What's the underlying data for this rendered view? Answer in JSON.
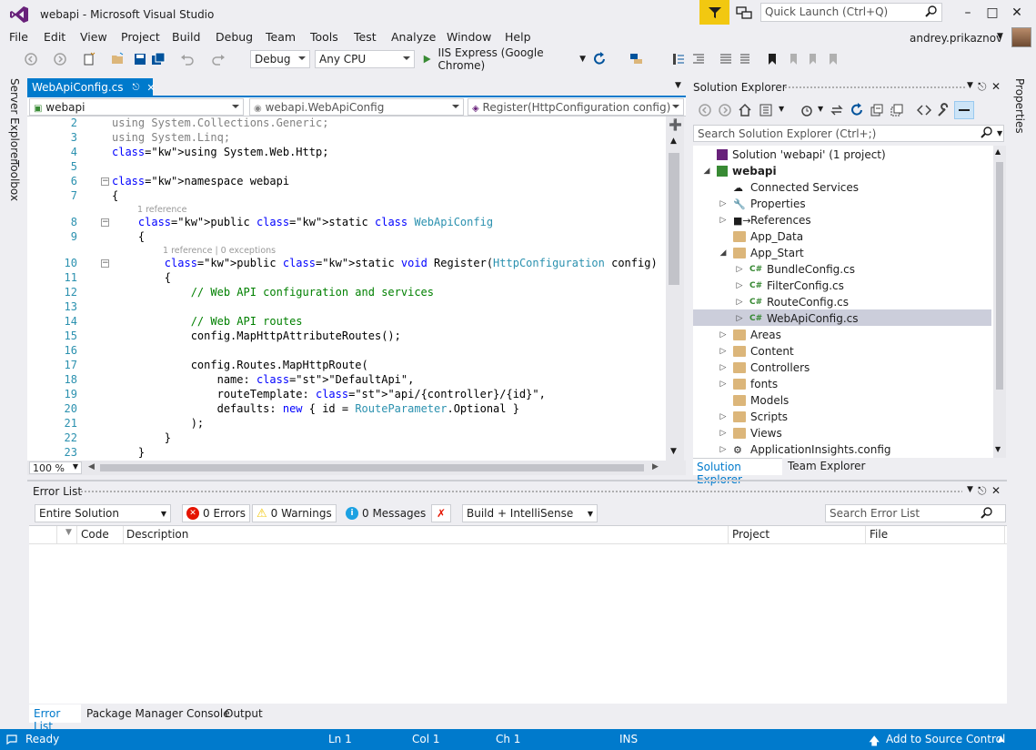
{
  "window": {
    "title": "webapi - Microsoft Visual Studio",
    "quick_launch_placeholder": "Quick Launch (Ctrl+Q)",
    "user": "andrey.prikaznov"
  },
  "menu": [
    "File",
    "Edit",
    "View",
    "Project",
    "Build",
    "Debug",
    "Team",
    "Tools",
    "Test",
    "Analyze",
    "Window",
    "Help"
  ],
  "toolbar": {
    "configuration": "Debug",
    "platform": "Any CPU",
    "run_target": "IIS Express (Google Chrome)"
  },
  "side_tabs": {
    "left": [
      "Server Explorer",
      "Toolbox"
    ],
    "right": [
      "Properties"
    ]
  },
  "editor": {
    "tab_label": "WebApiConfig.cs",
    "nav": {
      "project": "webapi",
      "type": "webapi.WebApiConfig",
      "member": "Register(HttpConfiguration config)"
    },
    "zoom": "100 %",
    "codelens_1": "1 reference",
    "codelens_2": "1 reference | 0 exceptions",
    "lines": [
      {
        "n": "2",
        "t": "using System.Collections.Generic;"
      },
      {
        "n": "3",
        "t": "using System.Linq;"
      },
      {
        "n": "4",
        "t": "using System.Web.Http;"
      },
      {
        "n": "5",
        "t": ""
      },
      {
        "n": "6",
        "t": "namespace webapi"
      },
      {
        "n": "7",
        "t": "{"
      },
      {
        "n": "8",
        "t": "    public static class WebApiConfig"
      },
      {
        "n": "9",
        "t": "    {"
      },
      {
        "n": "10",
        "t": "        public static void Register(HttpConfiguration config)"
      },
      {
        "n": "11",
        "t": "        {"
      },
      {
        "n": "12",
        "t": "            // Web API configuration and services"
      },
      {
        "n": "13",
        "t": ""
      },
      {
        "n": "14",
        "t": "            // Web API routes"
      },
      {
        "n": "15",
        "t": "            config.MapHttpAttributeRoutes();"
      },
      {
        "n": "16",
        "t": ""
      },
      {
        "n": "17",
        "t": "            config.Routes.MapHttpRoute("
      },
      {
        "n": "18",
        "t": "                name: \"DefaultApi\","
      },
      {
        "n": "19",
        "t": "                routeTemplate: \"api/{controller}/{id}\","
      },
      {
        "n": "20",
        "t": "                defaults: new { id = RouteParameter.Optional }"
      },
      {
        "n": "21",
        "t": "            );"
      },
      {
        "n": "22",
        "t": "        }"
      },
      {
        "n": "23",
        "t": "    }"
      }
    ]
  },
  "solution_explorer": {
    "title": "Solution Explorer",
    "search_placeholder": "Search Solution Explorer (Ctrl+;)",
    "items": [
      {
        "label": "Solution 'webapi' (1 project)"
      },
      {
        "label": "webapi"
      },
      {
        "label": "Connected Services"
      },
      {
        "label": "Properties"
      },
      {
        "label": "References"
      },
      {
        "label": "App_Data"
      },
      {
        "label": "App_Start"
      },
      {
        "label": "BundleConfig.cs"
      },
      {
        "label": "FilterConfig.cs"
      },
      {
        "label": "RouteConfig.cs"
      },
      {
        "label": "WebApiConfig.cs"
      },
      {
        "label": "Areas"
      },
      {
        "label": "Content"
      },
      {
        "label": "Controllers"
      },
      {
        "label": "fonts"
      },
      {
        "label": "Models"
      },
      {
        "label": "Scripts"
      },
      {
        "label": "Views"
      },
      {
        "label": "ApplicationInsights.config"
      }
    ],
    "tabs": [
      "Solution Explorer",
      "Team Explorer"
    ]
  },
  "error_list": {
    "title": "Error List",
    "scope": "Entire Solution",
    "errors": "0 Errors",
    "warnings": "0 Warnings",
    "messages": "0 Messages",
    "build_filter": "Build + IntelliSense",
    "search_placeholder": "Search Error List",
    "columns": [
      "Code",
      "Description",
      "Project",
      "File"
    ]
  },
  "bottom_tabs": [
    "Error List",
    "Package Manager Console",
    "Output"
  ],
  "status": {
    "ready": "Ready",
    "ln": "Ln 1",
    "col": "Col 1",
    "ch": "Ch 1",
    "ins": "INS",
    "source_control": "Add to Source Control"
  },
  "colors": {
    "accent": "#007acc",
    "chrome": "#eeeef2",
    "filter": "#f2c811"
  }
}
